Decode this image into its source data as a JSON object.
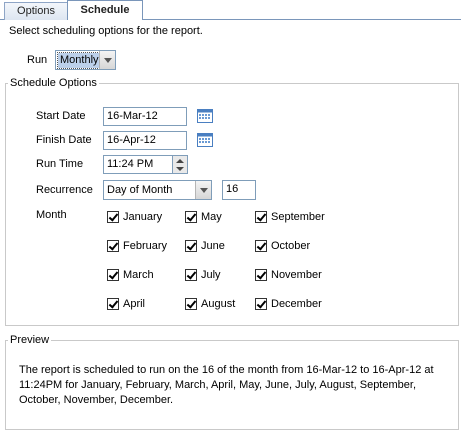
{
  "tabs": [
    {
      "label": "Options",
      "active": false
    },
    {
      "label": "Schedule",
      "active": true
    }
  ],
  "intro": "Select scheduling options for the report.",
  "run": {
    "label": "Run",
    "value": "Monthly"
  },
  "schedule_options": {
    "legend": "Schedule Options",
    "start_date": {
      "label": "Start Date",
      "value": "16-Mar-12"
    },
    "finish_date": {
      "label": "Finish Date",
      "value": "16-Apr-12"
    },
    "run_time": {
      "label": "Run Time",
      "value": "11:24 PM"
    },
    "recurrence": {
      "label": "Recurrence",
      "value": "Day of Month",
      "day": "16"
    },
    "month_label": "Month",
    "months": [
      {
        "label": "January",
        "checked": true
      },
      {
        "label": "February",
        "checked": true
      },
      {
        "label": "March",
        "checked": true
      },
      {
        "label": "April",
        "checked": true
      },
      {
        "label": "May",
        "checked": true
      },
      {
        "label": "June",
        "checked": true
      },
      {
        "label": "July",
        "checked": true
      },
      {
        "label": "August",
        "checked": true
      },
      {
        "label": "September",
        "checked": true
      },
      {
        "label": "October",
        "checked": true
      },
      {
        "label": "November",
        "checked": true
      },
      {
        "label": "December",
        "checked": true
      }
    ]
  },
  "preview": {
    "legend": "Preview",
    "text": "The report is scheduled to run on the 16 of the month from 16-Mar-12 to 16-Apr-12 at 11:24PM for January, February, March, April, May, June, July, August, September, October, November, December."
  },
  "icons": {
    "calendar": "calendar-icon",
    "spinner": "spin-buttons"
  },
  "colors": {
    "tab_border": "#7a96ba",
    "field_border": "#7f9db9",
    "selection": "#bcd0ea",
    "calendar": "#4a7fc1"
  }
}
